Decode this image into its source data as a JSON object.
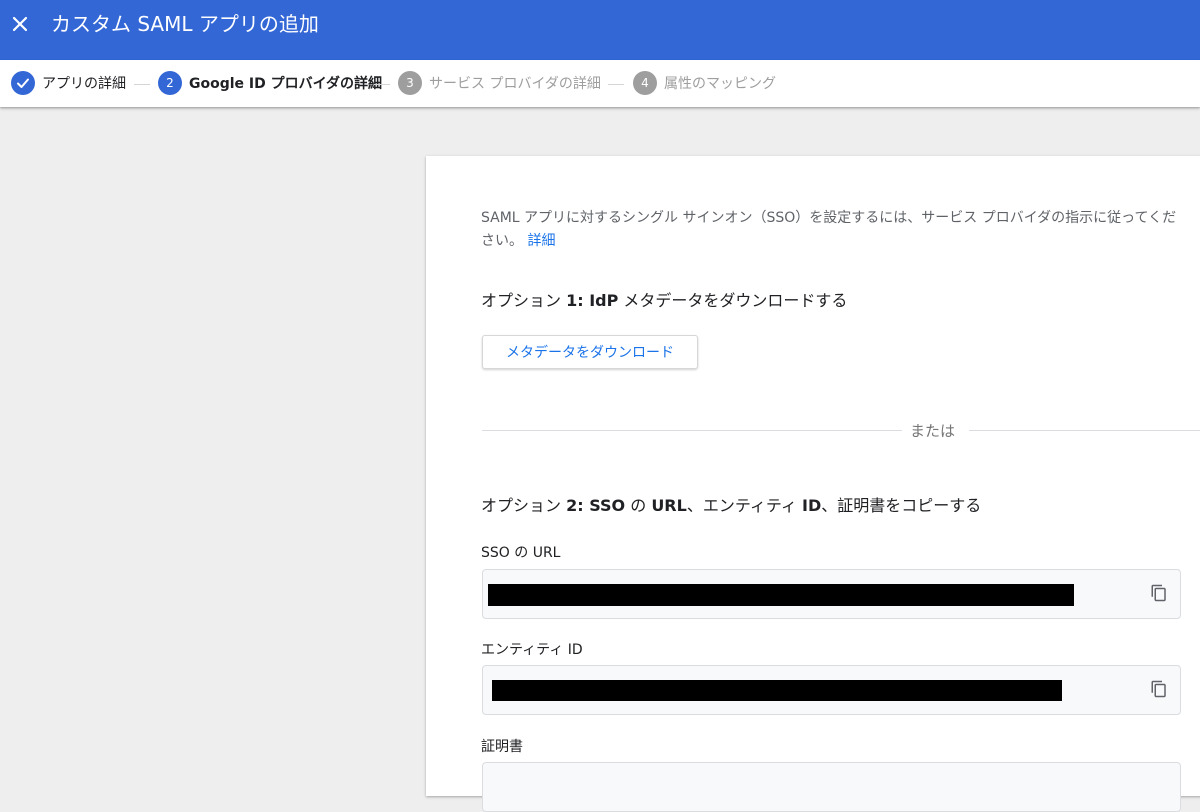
{
  "header": {
    "title": "カスタム SAML アプリの追加",
    "close_icon": "close-icon"
  },
  "stepper": {
    "steps": [
      {
        "number": "",
        "label": "アプリの詳細",
        "state": "done",
        "icon": "check-icon"
      },
      {
        "number": "2",
        "label": "Google ID プロバイダの詳細",
        "state": "active"
      },
      {
        "number": "3",
        "label": "サービス プロバイダの詳細",
        "state": "inactive"
      },
      {
        "number": "4",
        "label": "属性のマッピング",
        "state": "inactive"
      }
    ]
  },
  "main": {
    "intro_text": "SAML アプリに対するシングル サインオン（SSO）を設定するには、サービス プロバイダの指示に従ってください。",
    "intro_link": "詳細",
    "option1": {
      "heading_prefix": "オプション ",
      "heading_bold": "1: IdP",
      "heading_suffix": " メタデータをダウンロードする",
      "download_button": "メタデータをダウンロード"
    },
    "divider_text": "または",
    "option2": {
      "heading_prefix": "オプション ",
      "heading_bold1": "2: SSO",
      "heading_mid1": " の ",
      "heading_bold2": "URL",
      "heading_mid2": "、エンティティ ",
      "heading_bold3": "ID",
      "heading_suffix": "、証明書をコピーする"
    },
    "fields": [
      {
        "label": "SSO の URL",
        "value_redacted": true,
        "copy_icon": "copy-icon"
      },
      {
        "label": "エンティティ ID",
        "value_redacted": true,
        "copy_icon": "copy-icon"
      },
      {
        "label": "証明書"
      }
    ]
  },
  "colors": {
    "brand": "#3367d6",
    "link": "#1a73e8",
    "inactive": "#9e9e9e"
  }
}
